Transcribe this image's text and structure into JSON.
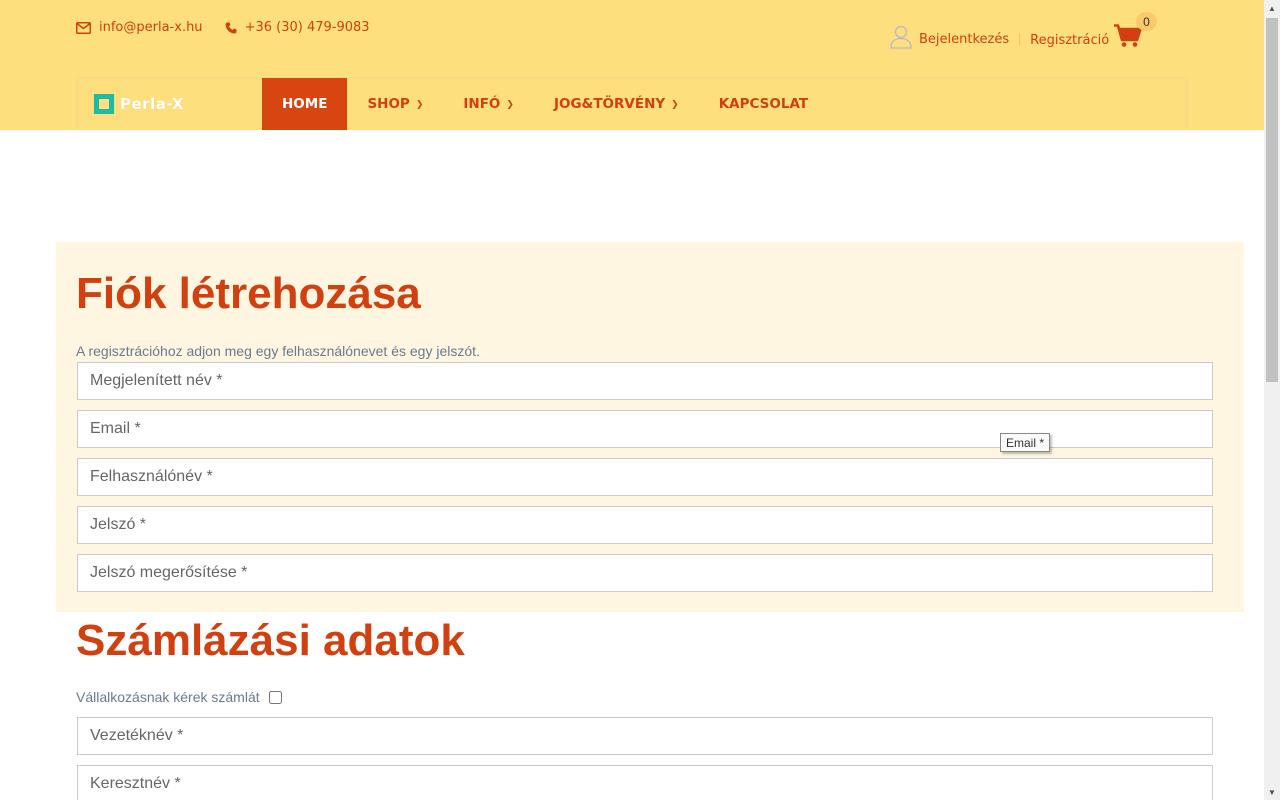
{
  "contact": {
    "email": "info@perla-x.hu",
    "phone": "+36 (30) 479-9083"
  },
  "account": {
    "login_label": "Bejelentkezés",
    "register_label": "Regisztráció",
    "cart_count": "0"
  },
  "logo": {
    "text": "Perla-X"
  },
  "nav": {
    "home": "HOME",
    "shop": "SHOP",
    "info": "INFÓ",
    "law": "JOG&TÖRVÉNY",
    "contact": "KAPCSOLAT"
  },
  "account_section": {
    "title": "Fiók létrehozása",
    "hint": "A regisztrációhoz adjon meg egy felhasználónevet és egy jelszót.",
    "display_name_placeholder": "Megjelenített név *",
    "email_placeholder": "Email *",
    "username_placeholder": "Felhasználónév *",
    "password_placeholder": "Jelszó *",
    "password_confirm_placeholder": "Jelszó megerősítése *",
    "tooltip": "Email *"
  },
  "billing_section": {
    "title": "Számlázási adatok",
    "company_label": "Vállalkozásnak kérek számlát",
    "lastname_placeholder": "Vezetéknév *",
    "firstname_placeholder": "Keresztnév *"
  },
  "colors": {
    "header_bg": "#fedf7e",
    "accent": "#d04010",
    "active_nav": "#d94510",
    "panel_bg": "#fef6e0"
  }
}
